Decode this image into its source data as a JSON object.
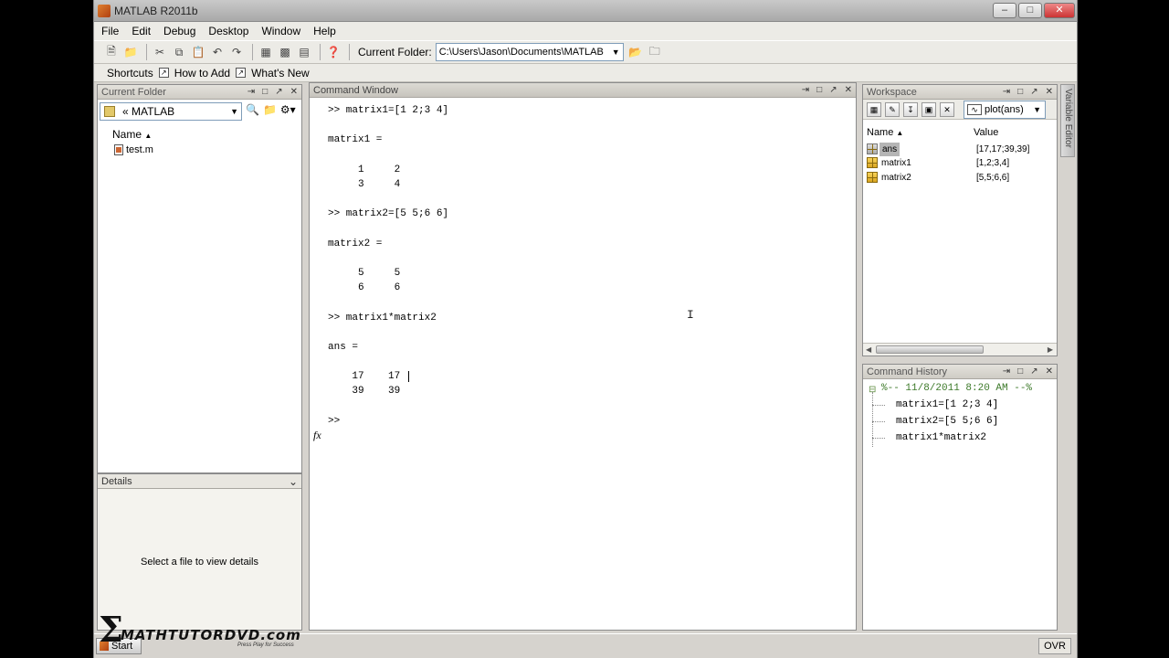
{
  "window": {
    "title": "MATLAB R2011b"
  },
  "menu": [
    "File",
    "Edit",
    "Debug",
    "Desktop",
    "Window",
    "Help"
  ],
  "toolbar": {
    "current_folder_label": "Current Folder:",
    "current_folder_path": "C:\\Users\\Jason\\Documents\\MATLAB"
  },
  "shortcuts": {
    "label": "Shortcuts",
    "how_to_add": "How to Add",
    "whats_new": "What's New"
  },
  "current_folder": {
    "title": "Current Folder",
    "path": "MATLAB",
    "path_prefix": "«",
    "column_name": "Name",
    "files": [
      "test.m"
    ]
  },
  "details": {
    "title": "Details",
    "message": "Select a file to view details"
  },
  "command_window": {
    "title": "Command Window",
    "lines": [
      ">> matrix1=[1 2;3 4]",
      "matrix1 =",
      "     1     2",
      "     3     4",
      ">> matrix2=[5 5;6 6]",
      "matrix2 =",
      "     5     5",
      "     6     6",
      ">> matrix1*matrix2",
      "ans =",
      "    17    17",
      "    39    39"
    ],
    "prompt": ">>",
    "fx_label": "fx"
  },
  "workspace": {
    "title": "Workspace",
    "plot_selector": "plot(ans)",
    "col_name": "Name",
    "col_value": "Value",
    "variables": [
      {
        "name": "ans",
        "value": "[17,17;39,39]"
      },
      {
        "name": "matrix1",
        "value": "[1,2;3,4]"
      },
      {
        "name": "matrix2",
        "value": "[5,5;6,6]"
      }
    ]
  },
  "variable_editor_tab": "Variable Editor",
  "command_history": {
    "title": "Command History",
    "session": "%-- 11/8/2011 8:20 AM --%",
    "entries": [
      "matrix1=[1 2;3 4]",
      "matrix2=[5 5;6 6]",
      "matrix1*matrix2"
    ]
  },
  "status": {
    "start": "Start",
    "ovr": "OVR"
  },
  "watermark": {
    "brand": "MATHTUTORDVD.com",
    "tagline": "Press Play for Success"
  }
}
